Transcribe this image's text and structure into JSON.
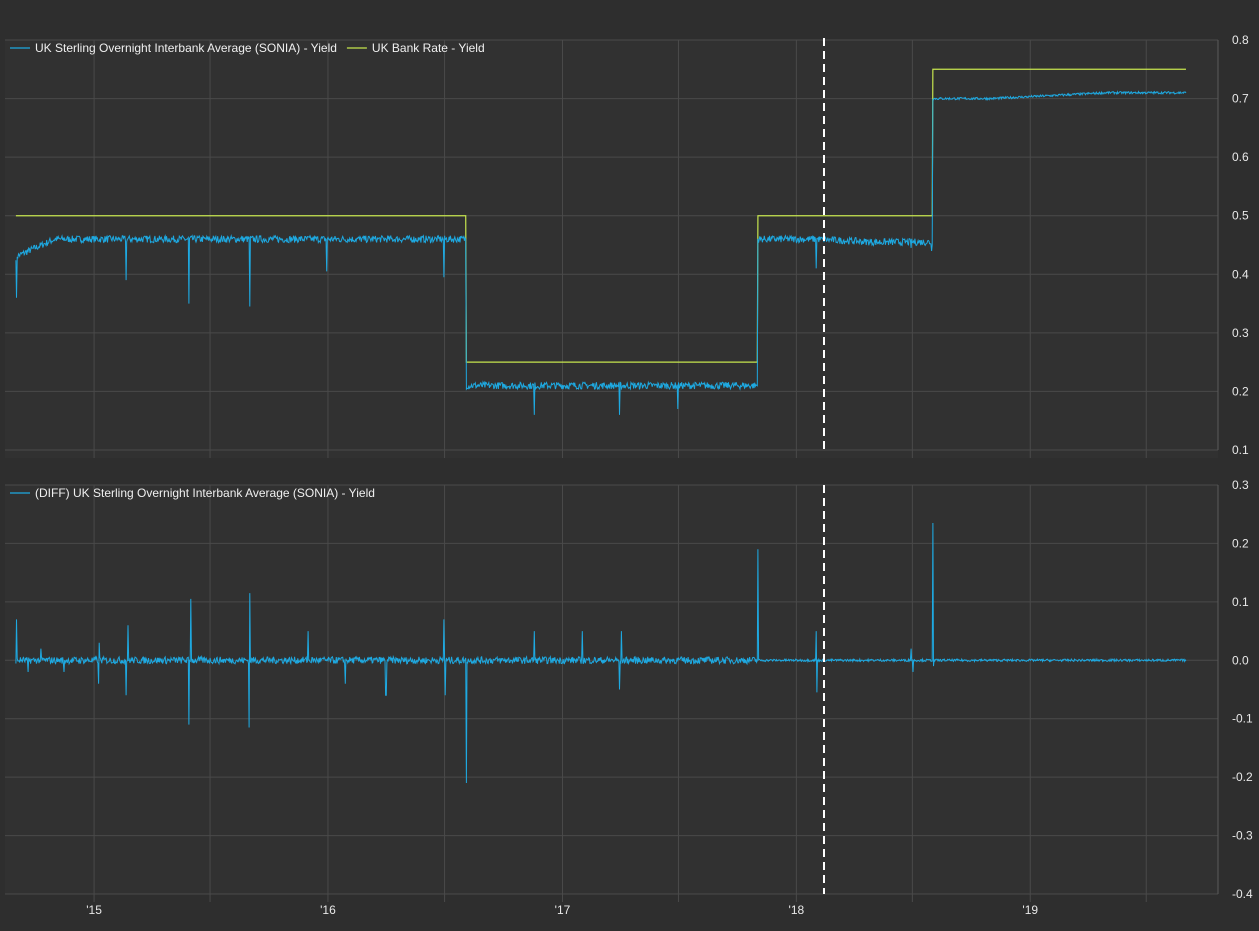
{
  "chart_data": [
    {
      "type": "line",
      "title": "",
      "xlabel": "",
      "ylabel": "",
      "ylim": [
        0.1,
        0.8
      ],
      "yticks": [
        0.1,
        0.2,
        0.3,
        0.4,
        0.5,
        0.6,
        0.7,
        0.8
      ],
      "x_unit": "date",
      "grid": true,
      "legend_position": "top-left",
      "series": [
        {
          "name": "UK Sterling Overnight Interbank Average (SONIA) - Yield",
          "color": "#1ea9e1",
          "points": [
            [
              "2014-09-01",
              0.43
            ],
            [
              "2014-10-01",
              0.445
            ],
            [
              "2014-11-01",
              0.46
            ],
            [
              "2015-01-01",
              0.46
            ],
            [
              "2015-04-01",
              0.46
            ],
            [
              "2015-07-01",
              0.46
            ],
            [
              "2015-10-01",
              0.46
            ],
            [
              "2016-01-01",
              0.46
            ],
            [
              "2016-04-01",
              0.46
            ],
            [
              "2016-07-01",
              0.46
            ],
            [
              "2016-08-03",
              0.46
            ],
            [
              "2016-08-04",
              0.21
            ],
            [
              "2016-11-01",
              0.21
            ],
            [
              "2017-02-01",
              0.21
            ],
            [
              "2017-05-01",
              0.21
            ],
            [
              "2017-08-01",
              0.21
            ],
            [
              "2017-11-01",
              0.21
            ],
            [
              "2017-11-02",
              0.46
            ],
            [
              "2018-02-01",
              0.46
            ],
            [
              "2018-05-01",
              0.455
            ],
            [
              "2018-08-01",
              0.455
            ],
            [
              "2018-08-02",
              0.7
            ],
            [
              "2018-11-01",
              0.7
            ],
            [
              "2019-02-01",
              0.705
            ],
            [
              "2019-05-01",
              0.71
            ],
            [
              "2019-09-01",
              0.71
            ]
          ],
          "spikes": [
            [
              "2014-09-02",
              0.36
            ],
            [
              "2015-02-20",
              0.39
            ],
            [
              "2015-05-29",
              0.35
            ],
            [
              "2015-09-01",
              0.345
            ],
            [
              "2015-12-30",
              0.405
            ],
            [
              "2016-06-30",
              0.395
            ],
            [
              "2016-11-18",
              0.16
            ],
            [
              "2017-03-31",
              0.16
            ],
            [
              "2017-06-30",
              0.17
            ],
            [
              "2018-02-01",
              0.41
            ],
            [
              "2018-06-29",
              0.445
            ],
            [
              "2018-07-31",
              0.44
            ]
          ]
        },
        {
          "name": "UK Bank Rate - Yield",
          "color": "#c6e54e",
          "points": [
            [
              "2014-09-01",
              0.5
            ],
            [
              "2016-08-03",
              0.5
            ],
            [
              "2016-08-04",
              0.25
            ],
            [
              "2017-11-01",
              0.25
            ],
            [
              "2017-11-02",
              0.5
            ],
            [
              "2018-08-01",
              0.5
            ],
            [
              "2018-08-02",
              0.75
            ],
            [
              "2019-09-01",
              0.75
            ]
          ]
        }
      ]
    },
    {
      "type": "line",
      "title": "",
      "xlabel": "",
      "ylabel": "",
      "ylim": [
        -0.4,
        0.3
      ],
      "yticks": [
        -0.4,
        -0.3,
        -0.2,
        -0.1,
        0.0,
        0.1,
        0.2,
        0.3
      ],
      "x_unit": "date",
      "grid": true,
      "legend_position": "top-left",
      "series": [
        {
          "name": "(DIFF) UK Sterling Overnight Interbank Average (SONIA) - Yield",
          "color": "#1ea9e1",
          "baseline": 0.0,
          "spikes": [
            [
              "2014-09-02",
              0.07
            ],
            [
              "2014-09-20",
              -0.02
            ],
            [
              "2014-10-10",
              0.02
            ],
            [
              "2014-11-15",
              -0.02
            ],
            [
              "2015-01-08",
              -0.04
            ],
            [
              "2015-01-09",
              0.03
            ],
            [
              "2015-02-20",
              -0.06
            ],
            [
              "2015-02-23",
              0.06
            ],
            [
              "2015-05-29",
              -0.11
            ],
            [
              "2015-06-01",
              0.105
            ],
            [
              "2015-08-31",
              -0.115
            ],
            [
              "2015-09-01",
              0.115
            ],
            [
              "2015-12-01",
              0.05
            ],
            [
              "2016-01-28",
              -0.04
            ],
            [
              "2016-03-31",
              -0.06
            ],
            [
              "2016-04-01",
              -0.06
            ],
            [
              "2016-06-30",
              0.07
            ],
            [
              "2016-07-02",
              -0.06
            ],
            [
              "2016-08-04",
              -0.21
            ],
            [
              "2016-11-18",
              0.05
            ],
            [
              "2017-02-01",
              0.05
            ],
            [
              "2017-03-31",
              -0.05
            ],
            [
              "2017-04-03",
              0.05
            ],
            [
              "2017-11-02",
              0.19
            ],
            [
              "2018-02-01",
              0.05
            ],
            [
              "2018-02-02",
              -0.055
            ],
            [
              "2018-06-29",
              0.02
            ],
            [
              "2018-07-02",
              -0.02
            ],
            [
              "2018-08-02",
              0.235
            ],
            [
              "2018-08-03",
              -0.01
            ]
          ]
        }
      ]
    }
  ],
  "x_axis": {
    "tick_labels": [
      "'15",
      "'16",
      "'17",
      "'18",
      "'19"
    ]
  }
}
